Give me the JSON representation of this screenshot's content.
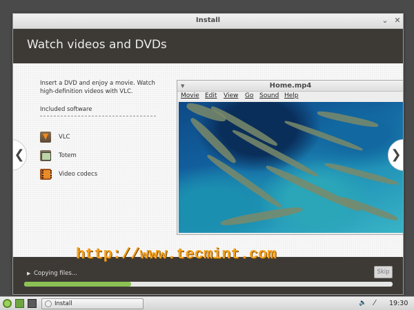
{
  "window": {
    "title": "Install"
  },
  "slide": {
    "title": "Watch videos and DVDs",
    "description": "Insert a DVD and enjoy a movie. Watch high-definition videos with VLC.",
    "included_heading": "Included software",
    "software": [
      {
        "label": "VLC",
        "icon": "vlc-icon"
      },
      {
        "label": "Totem",
        "icon": "totem-icon"
      },
      {
        "label": "Video codecs",
        "icon": "video-codecs-icon"
      }
    ]
  },
  "player": {
    "title": "Home.mp4",
    "menu": [
      "Movie",
      "Edit",
      "View",
      "Go",
      "Sound",
      "Help"
    ]
  },
  "progress": {
    "status": "Copying files...",
    "skip_label": "Skip",
    "fraction": 0.29
  },
  "watermark": "http://www.tecmint.com",
  "taskbar": {
    "task_label": "Install",
    "clock": "19:30"
  }
}
